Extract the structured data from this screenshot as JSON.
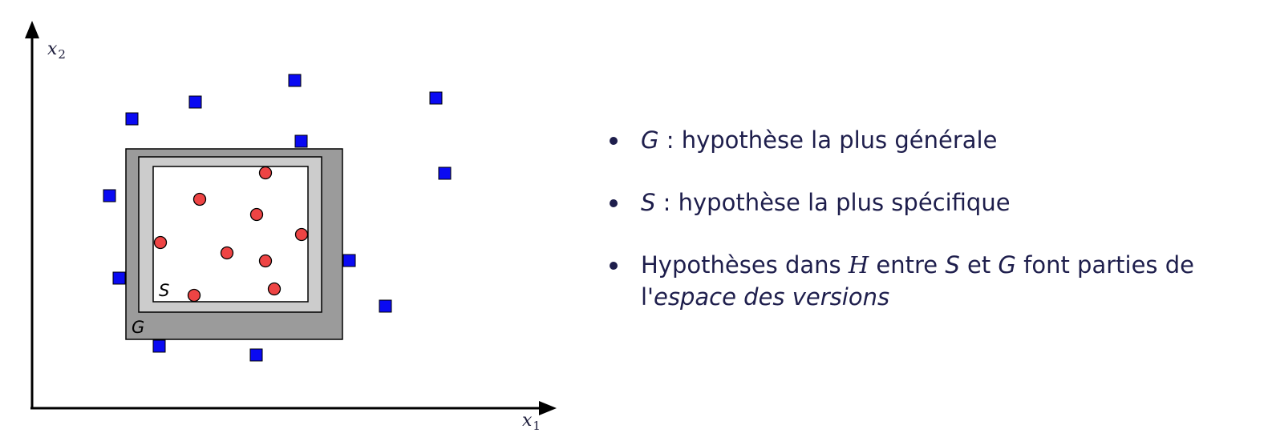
{
  "diagram": {
    "axis_x_label": "x",
    "axis_x_sub": "1",
    "axis_y_label": "x",
    "axis_y_sub": "2",
    "label_g": "G",
    "label_s": "S",
    "colors": {
      "square_fill": "#0a0af2",
      "circle_fill": "#ee4444",
      "g_fill": "#9b9b9b",
      "middle_fill": "#cccccc",
      "s_fill": "#ffffff",
      "bullet_text": "#1e1e4c"
    }
  },
  "bullets": [
    {
      "symbol": "G",
      "text": " : hypothèse la plus générale"
    },
    {
      "symbol": "S",
      "text": " : hypothèse la plus spécifique"
    },
    {
      "prefix": "Hypothèses dans ",
      "symbol_h": "H",
      "middle1": " entre ",
      "symbol_s": "S",
      "middle2": " et ",
      "symbol_g": "G",
      "middle3": " font parties de l'",
      "emph": "espace des versions"
    }
  ]
}
